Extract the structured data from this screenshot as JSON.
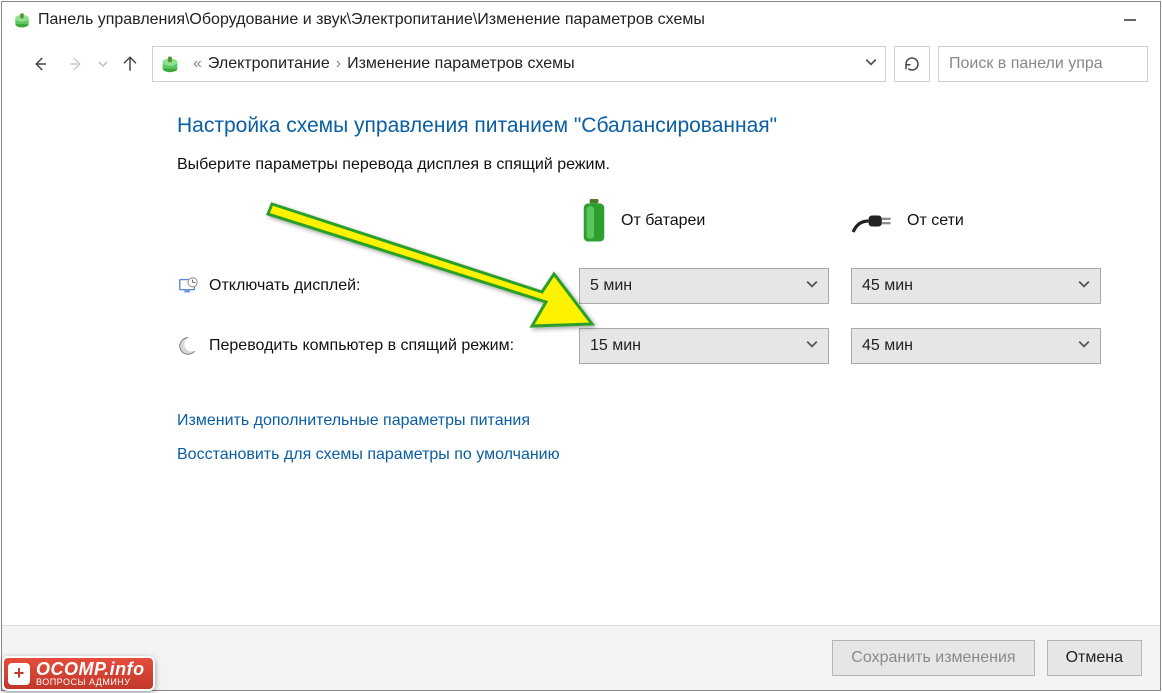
{
  "window": {
    "title": "Панель управления\\Оборудование и звук\\Электропитание\\Изменение параметров схемы"
  },
  "breadcrumb": {
    "item1": "Электропитание",
    "item2": "Изменение параметров схемы"
  },
  "search": {
    "placeholder": "Поиск в панели упра"
  },
  "page": {
    "heading": "Настройка схемы управления питанием \"Сбалансированная\"",
    "subtext": "Выберите параметры перевода дисплея в спящий режим."
  },
  "columns": {
    "battery": "От батареи",
    "plugged": "От сети"
  },
  "rows": {
    "display_off": "Отключать дисплей:",
    "sleep": "Переводить компьютер в спящий режим:"
  },
  "values": {
    "display_off_battery": "5 мин",
    "display_off_plugged": "45 мин",
    "sleep_battery": "15 мин",
    "sleep_plugged": "45 мин"
  },
  "links": {
    "advanced": "Изменить дополнительные параметры питания",
    "restore": "Восстановить для схемы параметры по умолчанию"
  },
  "buttons": {
    "save": "Сохранить изменения",
    "cancel": "Отмена"
  },
  "watermark": {
    "main": "OCOMP.info",
    "sub": "ВОПРОСЫ АДМИНУ"
  }
}
